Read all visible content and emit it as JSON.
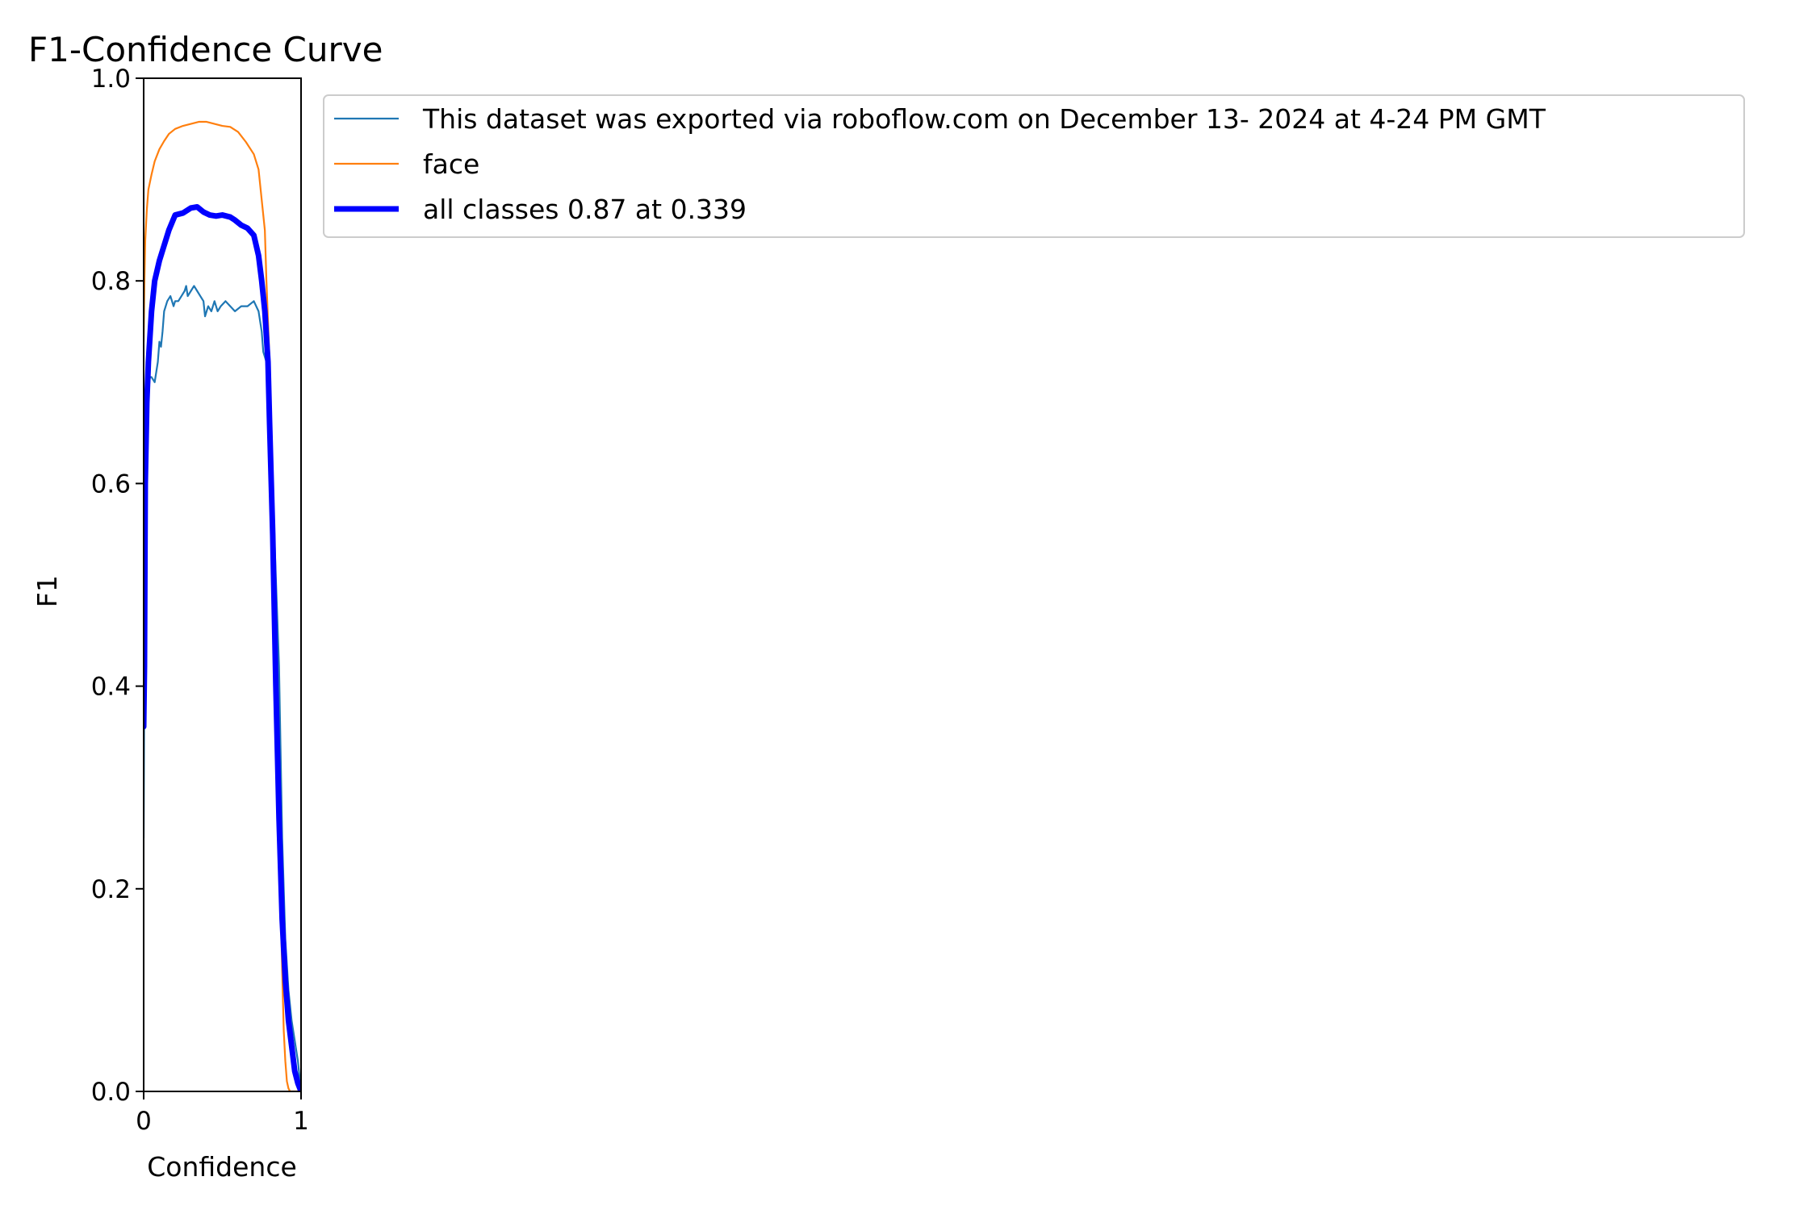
{
  "chart_data": {
    "type": "line",
    "title": "F1-Confidence Curve",
    "xlabel": "Confidence",
    "ylabel": "F1",
    "xlim": [
      0,
      1
    ],
    "ylim": [
      0,
      1
    ],
    "x_ticks": [
      "0",
      "1"
    ],
    "x_tick_values": [
      0,
      1
    ],
    "y_ticks": [
      "0.0",
      "0.2",
      "0.4",
      "0.6",
      "0.8",
      "1.0"
    ],
    "y_tick_values": [
      0,
      0.2,
      0.4,
      0.6,
      0.8,
      1.0
    ],
    "grid": false,
    "legend_position": "outside-right",
    "series": [
      {
        "name": "This dataset was exported via roboflow.com on December 13- 2024 at 4-24 PM GMT",
        "color": "#1f77b4",
        "line_width": "thin",
        "x": [
          0,
          0.005,
          0.01,
          0.02,
          0.03,
          0.04,
          0.05,
          0.07,
          0.09,
          0.1,
          0.11,
          0.12,
          0.13,
          0.15,
          0.17,
          0.19,
          0.2,
          0.22,
          0.24,
          0.26,
          0.27,
          0.28,
          0.3,
          0.32,
          0.34,
          0.36,
          0.38,
          0.39,
          0.41,
          0.43,
          0.45,
          0.47,
          0.49,
          0.52,
          0.55,
          0.58,
          0.62,
          0.66,
          0.7,
          0.73,
          0.75,
          0.76,
          0.78,
          0.8,
          0.83,
          0.86,
          0.88,
          0.9,
          0.92,
          0.94,
          0.96,
          0.98,
          1.0
        ],
        "y": [
          0.25,
          0.45,
          0.62,
          0.66,
          0.69,
          0.705,
          0.705,
          0.7,
          0.72,
          0.74,
          0.735,
          0.75,
          0.77,
          0.78,
          0.785,
          0.775,
          0.78,
          0.78,
          0.785,
          0.79,
          0.795,
          0.785,
          0.79,
          0.795,
          0.79,
          0.785,
          0.78,
          0.765,
          0.775,
          0.77,
          0.78,
          0.77,
          0.775,
          0.78,
          0.775,
          0.77,
          0.775,
          0.775,
          0.78,
          0.77,
          0.75,
          0.73,
          0.72,
          0.66,
          0.55,
          0.42,
          0.25,
          0.15,
          0.1,
          0.07,
          0.05,
          0.03,
          0.0
        ]
      },
      {
        "name": "face",
        "color": "#ff7f0e",
        "line_width": "thin",
        "x": [
          0,
          0.005,
          0.01,
          0.02,
          0.03,
          0.05,
          0.07,
          0.1,
          0.13,
          0.16,
          0.2,
          0.25,
          0.3,
          0.35,
          0.4,
          0.45,
          0.5,
          0.55,
          0.6,
          0.65,
          0.7,
          0.73,
          0.75,
          0.77,
          0.78,
          0.8,
          0.82,
          0.84,
          0.86,
          0.88,
          0.89,
          0.9,
          0.91,
          0.92,
          0.93,
          0.95,
          0.97,
          1.0
        ],
        "y": [
          0.74,
          0.8,
          0.84,
          0.87,
          0.89,
          0.905,
          0.918,
          0.93,
          0.938,
          0.945,
          0.95,
          0.953,
          0.955,
          0.957,
          0.957,
          0.955,
          0.953,
          0.952,
          0.947,
          0.937,
          0.925,
          0.91,
          0.88,
          0.85,
          0.8,
          0.72,
          0.58,
          0.4,
          0.25,
          0.12,
          0.06,
          0.03,
          0.01,
          0.003,
          0.0,
          0.0,
          0.0,
          0.0
        ]
      },
      {
        "name": "all classes 0.87 at 0.339",
        "color": "#0000ff",
        "line_width": "thick",
        "x": [
          0,
          0.005,
          0.01,
          0.02,
          0.03,
          0.05,
          0.07,
          0.1,
          0.13,
          0.16,
          0.2,
          0.25,
          0.3,
          0.34,
          0.38,
          0.42,
          0.46,
          0.5,
          0.55,
          0.58,
          0.62,
          0.66,
          0.7,
          0.73,
          0.75,
          0.77,
          0.79,
          0.8,
          0.82,
          0.84,
          0.86,
          0.88,
          0.9,
          0.92,
          0.94,
          0.96,
          0.98,
          1.0
        ],
        "y": [
          0.36,
          0.42,
          0.6,
          0.68,
          0.72,
          0.77,
          0.8,
          0.82,
          0.835,
          0.85,
          0.865,
          0.867,
          0.872,
          0.873,
          0.868,
          0.865,
          0.864,
          0.865,
          0.863,
          0.86,
          0.855,
          0.852,
          0.845,
          0.825,
          0.8,
          0.77,
          0.72,
          0.66,
          0.55,
          0.4,
          0.27,
          0.17,
          0.11,
          0.07,
          0.045,
          0.02,
          0.008,
          0.0
        ]
      }
    ]
  }
}
